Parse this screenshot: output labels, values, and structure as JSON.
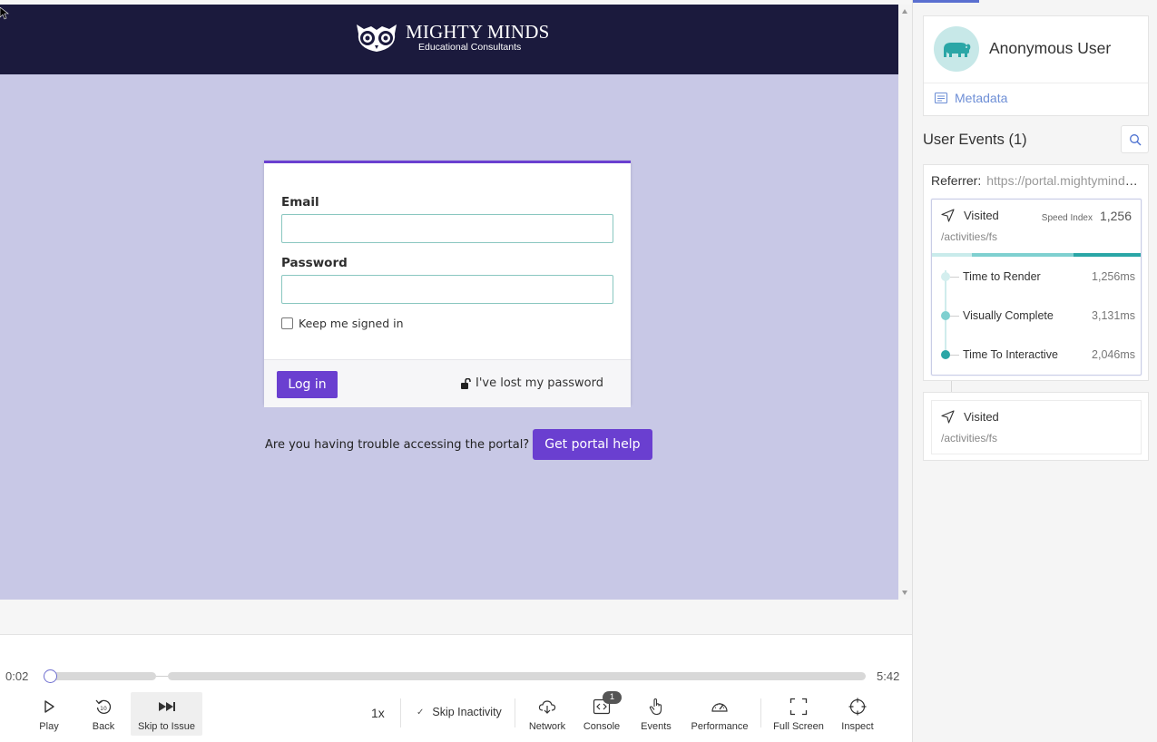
{
  "site": {
    "logo_name": "MIGHTY MINDS",
    "logo_subtitle": "Educational Consultants",
    "login": {
      "email_label": "Email",
      "email_value": "",
      "password_label": "Password",
      "password_value": "",
      "keep_signed_in": "Keep me signed in",
      "keep_signed_in_checked": false,
      "login_button": "Log in",
      "lost_password": "I've lost my password"
    },
    "trouble_text": "Are you having trouble accessing the portal?",
    "help_button": "Get portal help",
    "colors": {
      "header": "#1b1a3d",
      "background": "#c8c8e6",
      "accent": "#6a3fd0"
    }
  },
  "player": {
    "current_time": "0:02",
    "total_time": "5:42",
    "progress": 0.006,
    "controls": {
      "play": "Play",
      "back": "Back",
      "back_seconds": "10",
      "skip_to_issue": "Skip to Issue",
      "speed": "1x",
      "skip_inactivity": "Skip Inactivity",
      "network": "Network",
      "console": "Console",
      "console_count": "1",
      "events": "Events",
      "performance": "Performance",
      "full_screen": "Full Screen",
      "inspect": "Inspect"
    }
  },
  "sidebar": {
    "user_name": "Anonymous User",
    "metadata_label": "Metadata",
    "events_title": "User Events (1)",
    "referrer_label": "Referrer:",
    "referrer_value": "https://portal.mightyminds.com.au/",
    "events": [
      {
        "type": "Visited",
        "path": "/activities/fs",
        "speed_index_label": "Speed Index",
        "speed_index": "1,256",
        "metrics": [
          {
            "name": "Time to Render",
            "value": "1,256ms"
          },
          {
            "name": "Visually Complete",
            "value": "3,131ms"
          },
          {
            "name": "Time To Interactive",
            "value": "2,046ms"
          }
        ]
      },
      {
        "type": "Visited",
        "path": "/activities/fs"
      }
    ],
    "colors": {
      "teal_light": "#c9ebeb",
      "teal_mid": "#7fd0d0",
      "teal_dark": "#2aa6a6",
      "link": "#6e8fd6"
    }
  }
}
